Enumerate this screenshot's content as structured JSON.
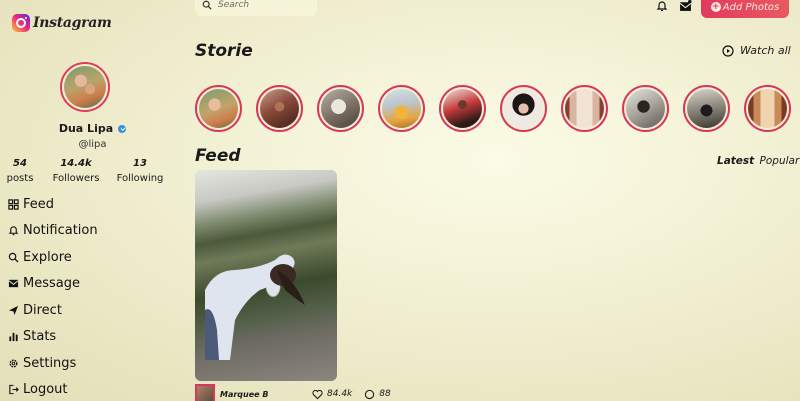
{
  "app": {
    "logo_text": "Instagram"
  },
  "profile": {
    "name": "Dua Lipa",
    "handle": "@lipa",
    "stats": [
      {
        "value": "54",
        "label": "posts"
      },
      {
        "value": "14.4k",
        "label": "Followers"
      },
      {
        "value": "13",
        "label": "Following"
      }
    ]
  },
  "nav": [
    {
      "label": "Feed",
      "icon": "grid-icon"
    },
    {
      "label": "Notification",
      "icon": "bell-icon"
    },
    {
      "label": "Explore",
      "icon": "search-icon"
    },
    {
      "label": "Message",
      "icon": "mail-icon"
    },
    {
      "label": "Direct",
      "icon": "send-icon"
    },
    {
      "label": "Stats",
      "icon": "bar-chart-icon"
    },
    {
      "label": "Settings",
      "icon": "gear-icon"
    },
    {
      "label": "Logout",
      "icon": "logout-icon"
    }
  ],
  "header": {
    "search_placeholder": "Search",
    "add_photos_label": "Add Photos"
  },
  "stories": {
    "title": "Storie",
    "watch_all_label": "Watch all"
  },
  "feed": {
    "title": "Feed",
    "tabs": {
      "latest": "Latest",
      "popular": "Popular"
    },
    "posts": [
      {
        "author": "Marquee B",
        "likes": "84.4k",
        "comments": "88"
      }
    ]
  },
  "colors": {
    "accent": "#e23a5e",
    "story_ring": "#d8365c",
    "verified": "#3b8ee0"
  }
}
